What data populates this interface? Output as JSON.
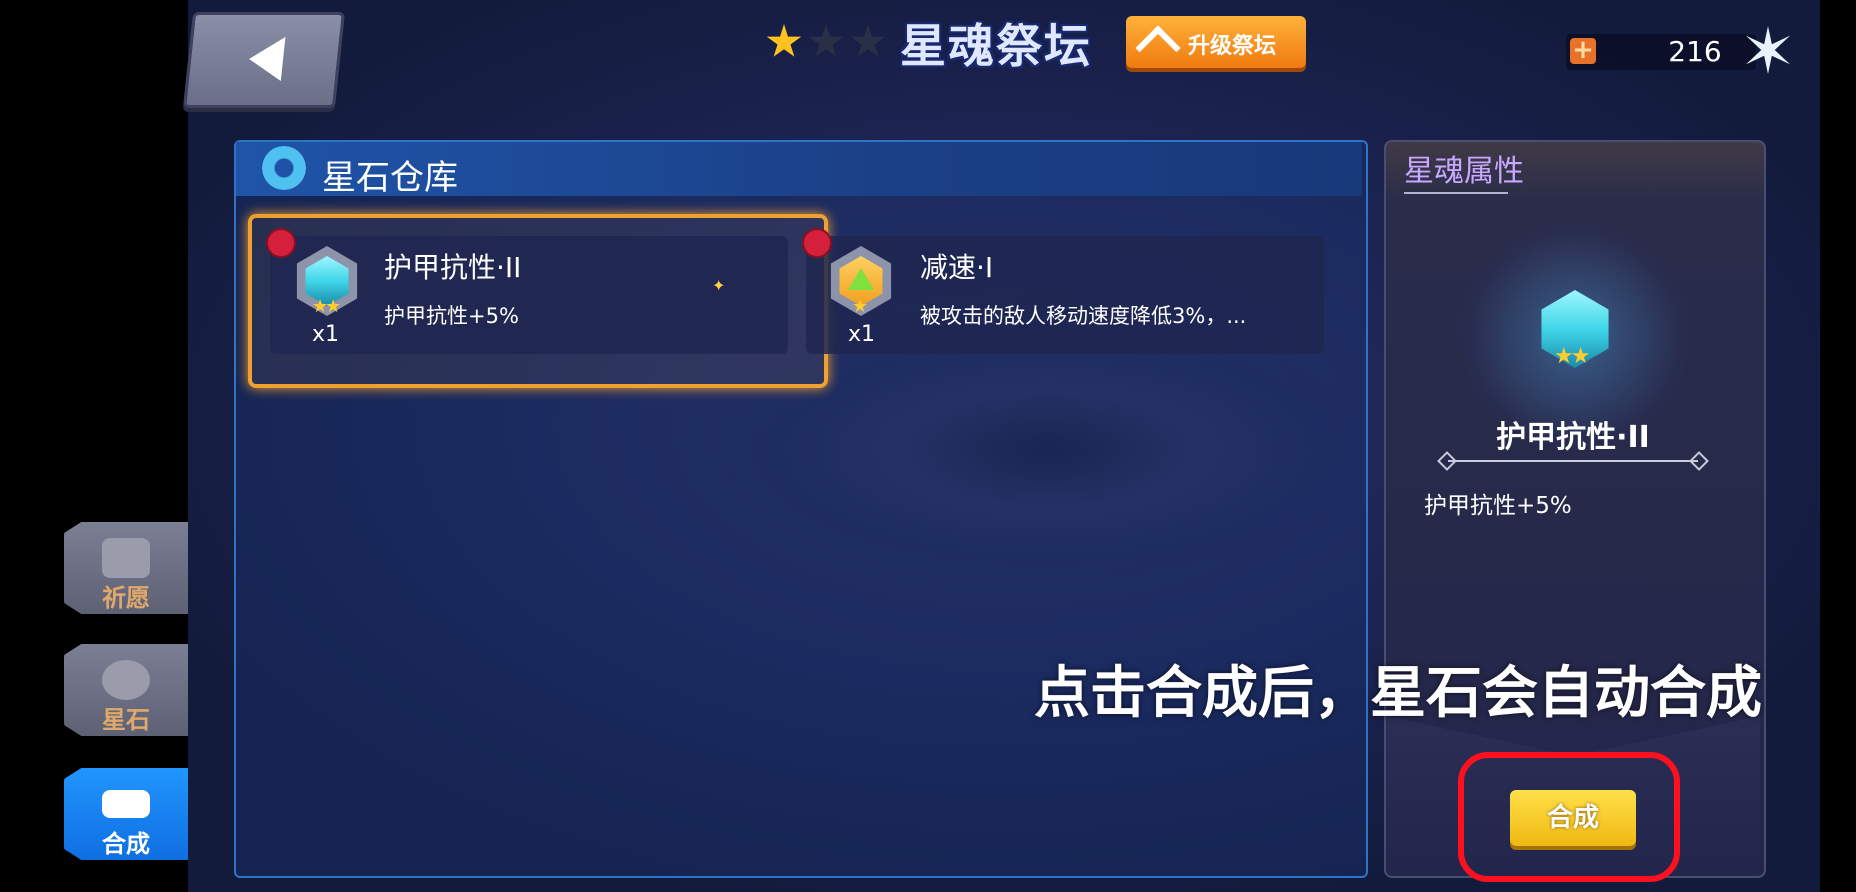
{
  "header": {
    "title": "星魂祭坛",
    "altar_stars": {
      "filled": 1,
      "total": 3
    },
    "upgrade_button": "升级祭坛",
    "currency": "216"
  },
  "side_nav": {
    "items": [
      {
        "label": "祈愿",
        "active": false
      },
      {
        "label": "星石",
        "active": false
      },
      {
        "label": "合成",
        "active": true
      }
    ]
  },
  "warehouse": {
    "title": "星石仓库",
    "items": [
      {
        "name": "护甲抗性·II",
        "desc": "护甲抗性+5%",
        "count": "x1",
        "stars": 2,
        "gem_color": "#3fd6e8",
        "selected": true
      },
      {
        "name": "减速·I",
        "desc": "被攻击的敌人移动速度降低3%，...",
        "count": "x1",
        "stars": 1,
        "gem_color": "#f0a020",
        "selected": false
      }
    ]
  },
  "attributes": {
    "title": "星魂属性",
    "name": "护甲抗性·II",
    "desc": "护甲抗性+5%",
    "compose_button": "合成"
  },
  "caption": "点击合成后，星石会自动合成",
  "colors": {
    "accent_orange": "#f07a10",
    "compose_yellow": "#f0b812",
    "highlight_red": "#ff1020",
    "panel_blue": "#2e73c8"
  }
}
